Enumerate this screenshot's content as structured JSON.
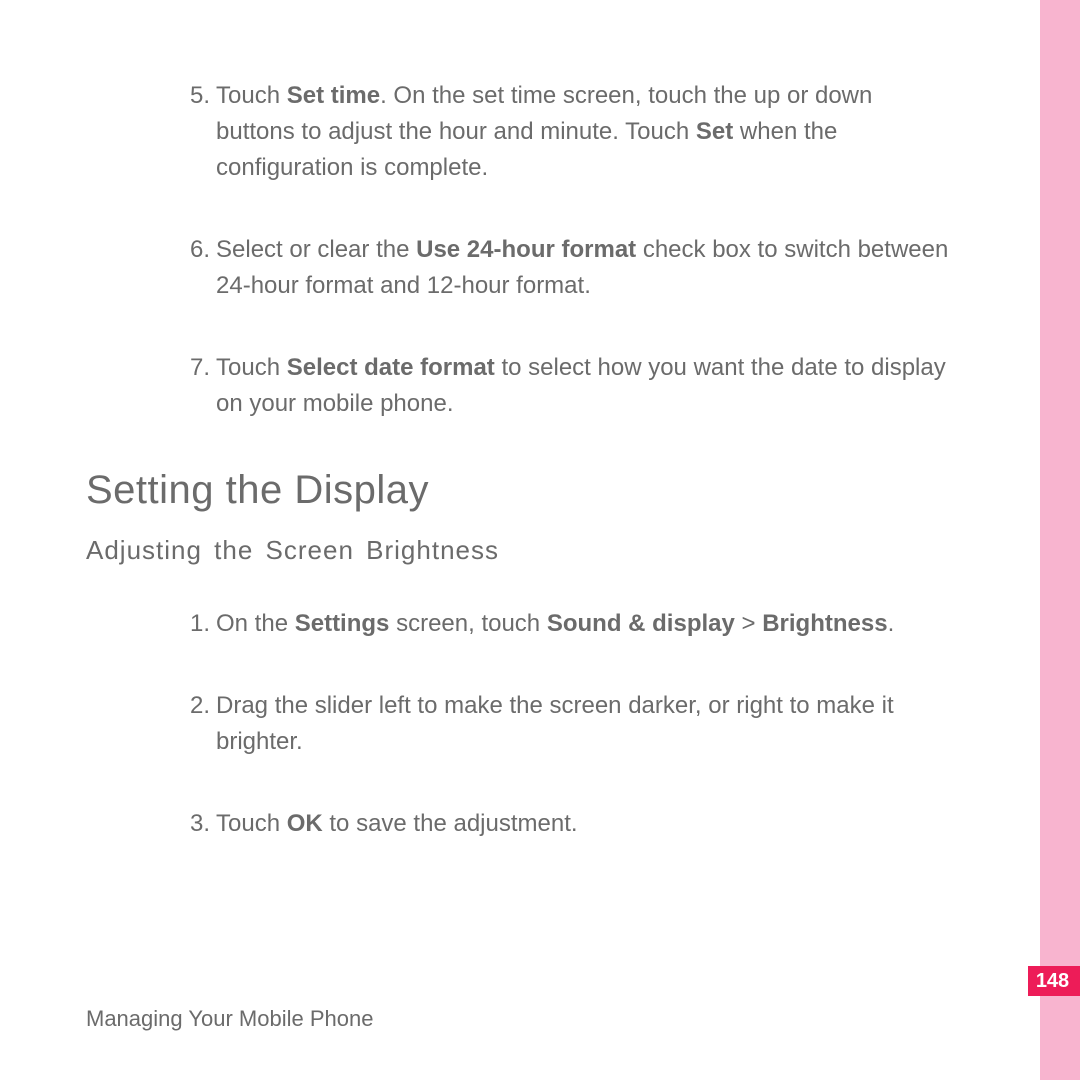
{
  "steps_a": [
    {
      "num": "5.",
      "parts": [
        {
          "t": "Touch "
        },
        {
          "t": "Set time",
          "b": true
        },
        {
          "t": ". On the set time screen, touch the up or down buttons to adjust the hour and minute. Touch "
        },
        {
          "t": "Set",
          "b": true
        },
        {
          "t": " when the configuration is complete."
        }
      ]
    },
    {
      "num": "6.",
      "parts": [
        {
          "t": "Select or clear the "
        },
        {
          "t": "Use 24-hour format",
          "b": true
        },
        {
          "t": " check box to switch between 24-hour format and 12-hour format."
        }
      ]
    },
    {
      "num": "7.",
      "parts": [
        {
          "t": "Touch "
        },
        {
          "t": "Select date format",
          "b": true
        },
        {
          "t": " to select how you want the date to display on your mobile phone."
        }
      ]
    }
  ],
  "heading": "Setting the Display",
  "subheading": "Adjusting the Screen Brightness",
  "steps_b": [
    {
      "num": "1.",
      "parts": [
        {
          "t": "On the "
        },
        {
          "t": "Settings",
          "b": true
        },
        {
          "t": " screen, touch "
        },
        {
          "t": "Sound & display",
          "b": true
        },
        {
          "t": " > "
        },
        {
          "t": "Brightness",
          "b": true
        },
        {
          "t": "."
        }
      ]
    },
    {
      "num": "2.",
      "parts": [
        {
          "t": "Drag the slider left to make the screen darker, or right to make it brighter."
        }
      ]
    },
    {
      "num": "3.",
      "parts": [
        {
          "t": "Touch "
        },
        {
          "t": "OK",
          "b": true
        },
        {
          "t": " to save the adjustment."
        }
      ]
    }
  ],
  "footer": "Managing Your Mobile Phone",
  "page_number": "148"
}
